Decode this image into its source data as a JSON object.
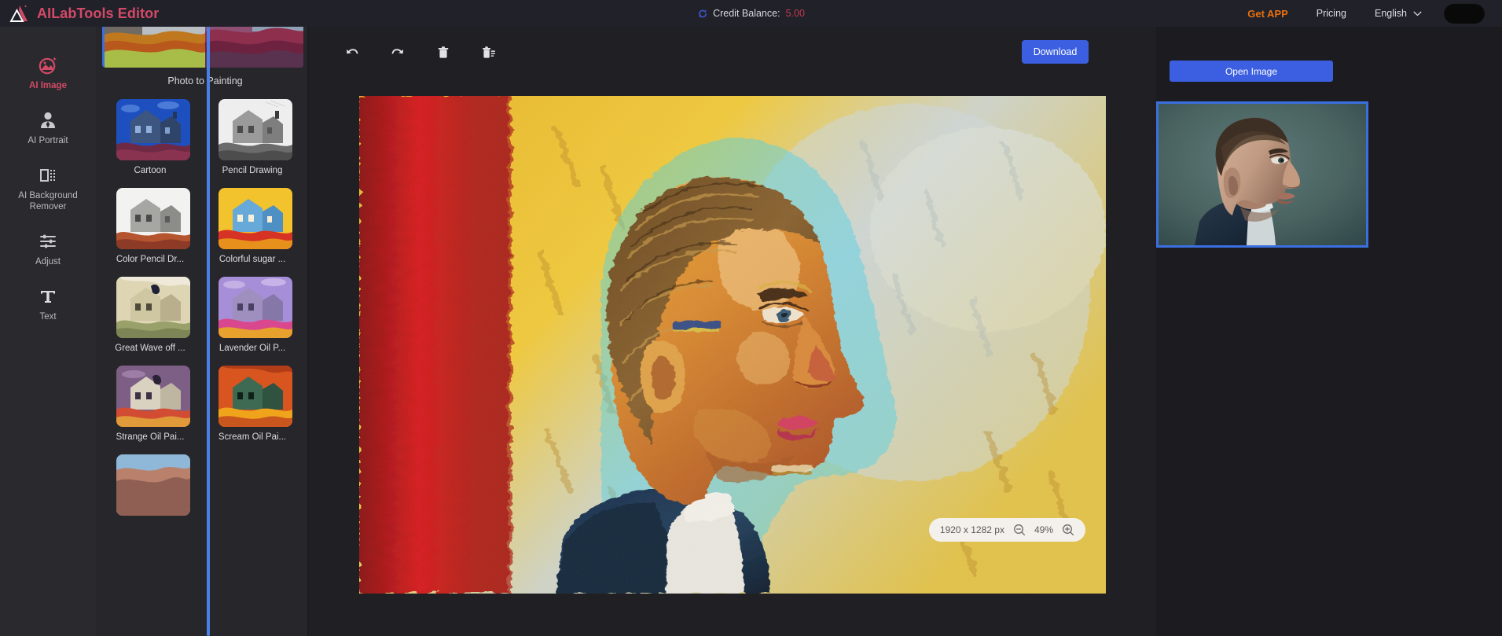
{
  "app": {
    "brand_title": "AILabTools Editor",
    "logo_icon": "ailab-logo-icon"
  },
  "header": {
    "credit_label": "Credit Balance:",
    "credit_value": "5.00",
    "credit_icon": "refresh-icon",
    "get_app_label": "Get APP",
    "pricing_label": "Pricing",
    "language_label": "English",
    "language_chevron_icon": "chevron-down-icon",
    "avatar_icon": "avatar"
  },
  "sidebar": {
    "items": [
      {
        "label": "AI Image",
        "icon": "ai-image-icon",
        "active": true
      },
      {
        "label": "AI Portrait",
        "icon": "ai-portrait-icon",
        "active": false
      },
      {
        "label": "AI Background Remover",
        "icon": "background-remover-icon",
        "active": false
      },
      {
        "label": "Adjust",
        "icon": "sliders-icon",
        "active": false
      },
      {
        "label": "Text",
        "icon": "text-icon",
        "active": false
      }
    ]
  },
  "style_panel": {
    "hero_label": "Photo to Painting",
    "styles": [
      {
        "label": "Cartoon"
      },
      {
        "label": "Pencil Drawing"
      },
      {
        "label": "Color Pencil Dr..."
      },
      {
        "label": "Colorful sugar ..."
      },
      {
        "label": "Great Wave off ..."
      },
      {
        "label": "Lavender Oil P..."
      },
      {
        "label": "Strange Oil Pai..."
      },
      {
        "label": "Scream Oil Pai..."
      }
    ]
  },
  "toolbar": {
    "undo_label": "Undo",
    "undo_icon": "undo-icon",
    "redo_label": "Redo",
    "redo_icon": "redo-icon",
    "delete_label": "Delete",
    "delete_icon": "trash-icon",
    "clear_label": "Clear All",
    "clear_icon": "trash-list-icon",
    "download_label": "Download"
  },
  "canvas": {
    "dimensions_label": "1920 x 1282 px",
    "zoom_level": "49%",
    "zoom_out_icon": "zoom-out-icon",
    "zoom_in_icon": "zoom-in-icon"
  },
  "right_panel": {
    "open_image_label": "Open Image",
    "preview_icon": "source-image-preview"
  },
  "colors": {
    "brand": "#d24a67",
    "accent_blue": "#3b5fe0",
    "get_app_orange": "#e8700e",
    "credit_value": "#c0394f",
    "topbar_bg": "#21212a",
    "nav_bg": "#2a2a2e",
    "panel_bg": "#26262b",
    "canvas_bg": "#202024",
    "right_bg": "#1c1c20"
  }
}
